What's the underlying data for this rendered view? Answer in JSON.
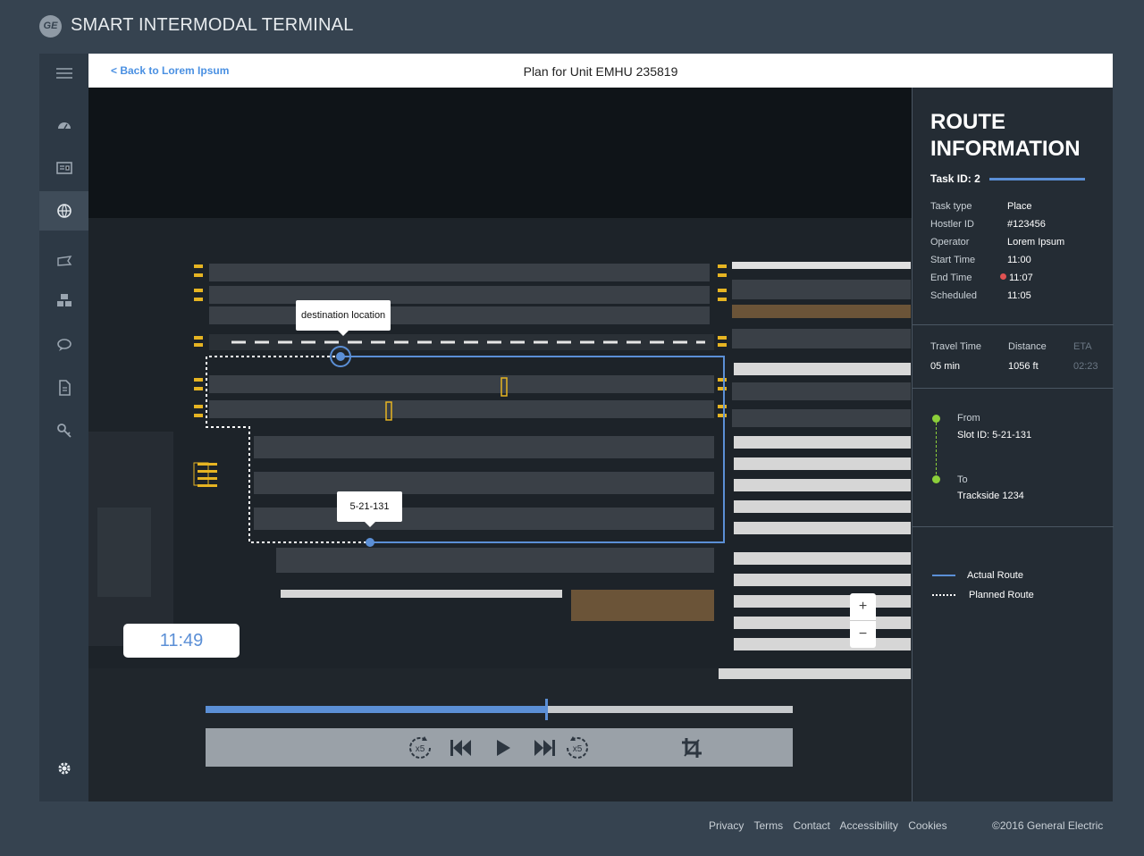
{
  "app": {
    "logo_text": "GE",
    "title": "SMART INTERMODAL TERMINAL"
  },
  "nav": {
    "items": [
      {
        "icon": "menu-icon"
      },
      {
        "icon": "dashboard-icon"
      },
      {
        "icon": "newspaper-icon"
      },
      {
        "icon": "globe-icon",
        "active": true
      },
      {
        "icon": "flag-icon"
      },
      {
        "icon": "containers-icon"
      },
      {
        "icon": "chat-icon"
      },
      {
        "icon": "document-icon"
      },
      {
        "icon": "key-icon"
      },
      {
        "icon": "gear-icon"
      }
    ]
  },
  "header": {
    "back_label": "< Back to Lorem Ipsum",
    "title": "Plan for Unit EMHU 235819"
  },
  "map": {
    "destination_tooltip": "destination location",
    "origin_tooltip": "5-21-131",
    "current_time": "11:49",
    "zoom_in": "+",
    "zoom_out": "−",
    "playback_progress": 0.58,
    "speed_label_back": "x5",
    "speed_label_forward": "x5"
  },
  "route": {
    "heading": "ROUTE INFORMATION",
    "task_id": "Task ID: 2",
    "details": [
      {
        "label": "Task type",
        "value": "Place"
      },
      {
        "label": "Hostler ID",
        "value": "#123456"
      },
      {
        "label": "Operator",
        "value": "Lorem Ipsum"
      },
      {
        "label": "Start Time",
        "value": "11:00"
      },
      {
        "label": "End Time",
        "value": "11:07",
        "late": true
      },
      {
        "label": "Scheduled",
        "value": "11:05"
      }
    ],
    "stats": {
      "travel_label": "Travel Time",
      "travel_value": "05 min",
      "distance_label": "Distance",
      "distance_value": "1056 ft",
      "eta_label": "ETA",
      "eta_value": "02:23"
    },
    "from_label": "From",
    "from_value": "Slot ID: 5-21-131",
    "to_label": "To",
    "to_value": "Trackside 1234",
    "legend": [
      {
        "label": "Actual Route",
        "color": "#5b8fd6"
      },
      {
        "label": "Planned Route",
        "color": "#ffffff"
      }
    ]
  },
  "footer": {
    "links": [
      "Privacy",
      "Terms",
      "Contact",
      "Accessibility",
      "Cookies"
    ],
    "copyright": "©2016 General Electric"
  },
  "colors": {
    "accent": "#5b8fd6",
    "late": "#e05252",
    "from_to": "#8ccf3a"
  }
}
